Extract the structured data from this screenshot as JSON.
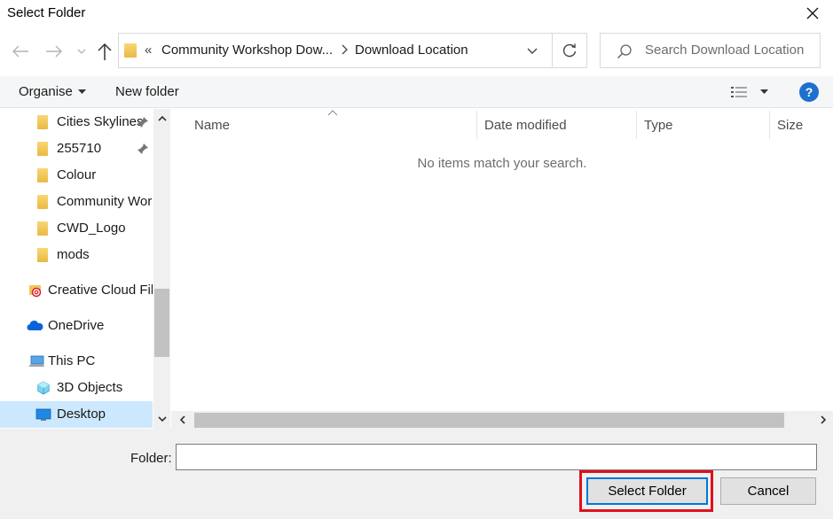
{
  "window": {
    "title": "Select Folder",
    "close_icon": "close-icon"
  },
  "navigation": {
    "back_icon": "arrow-left-icon",
    "forward_icon": "arrow-right-icon",
    "recent_icon": "chevron-down-icon",
    "up_icon": "arrow-up-icon"
  },
  "address": {
    "overflow": "«",
    "crumbs": [
      "Community Workshop Dow...",
      "Download Location"
    ],
    "refresh_icon": "refresh-icon"
  },
  "search": {
    "placeholder": "Search Download Location"
  },
  "toolbar": {
    "organise_label": "Organise",
    "new_folder_label": "New folder",
    "help_label": "?"
  },
  "nav_pane": {
    "items": [
      {
        "label": "Cities Skylines",
        "icon": "folder-icon",
        "pinned": true
      },
      {
        "label": "255710",
        "icon": "folder-icon",
        "pinned": true
      },
      {
        "label": "Colour",
        "icon": "folder-icon",
        "pinned": false
      },
      {
        "label": "Community Workshop",
        "icon": "folder-icon",
        "pinned": false
      },
      {
        "label": "CWD_Logo",
        "icon": "folder-icon",
        "pinned": false
      },
      {
        "label": "mods",
        "icon": "folder-icon",
        "pinned": false
      },
      {
        "label": "Creative Cloud Files",
        "icon": "creative-cloud-icon",
        "pinned": false
      },
      {
        "label": "OneDrive",
        "icon": "onedrive-cloud-icon",
        "pinned": false
      },
      {
        "label": "This PC",
        "icon": "computer-icon",
        "pinned": false
      },
      {
        "label": "3D Objects",
        "icon": "3d-objects-icon",
        "pinned": false
      },
      {
        "label": "Desktop",
        "icon": "desktop-icon",
        "pinned": false,
        "selected": true
      }
    ]
  },
  "file_list": {
    "columns": [
      "Name",
      "Date modified",
      "Type",
      "Size"
    ],
    "empty_message": "No items match your search."
  },
  "footer": {
    "folder_label": "Folder:",
    "folder_value": "",
    "select_label": "Select Folder",
    "cancel_label": "Cancel"
  },
  "colors": {
    "accent": "#0078d7",
    "highlight": "#e0101c",
    "selected_nav": "#cce8ff",
    "help_icon_bg": "#1f6fd0"
  }
}
